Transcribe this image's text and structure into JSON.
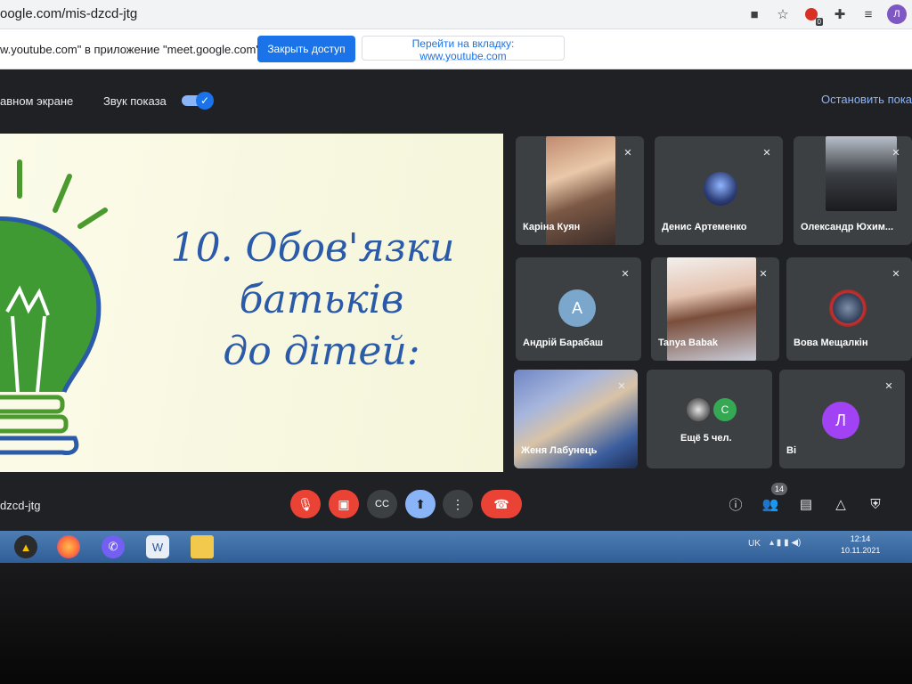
{
  "browser": {
    "url": "oogle.com/mis-dzcd-jtg",
    "profile_initial": "Л",
    "notif_count": "0",
    "icons": [
      "camera-icon",
      "star-icon",
      "extension-badge-icon",
      "puzzle-icon",
      "reading-list-icon",
      "profile-avatar"
    ]
  },
  "infobar": {
    "message": "w.youtube.com\" в приложение \"meet.google.com\" ...",
    "close_access": "Закрыть доступ",
    "go_to_tab": "Перейти на вкладку: www.youtube.com"
  },
  "presentation": {
    "main_screen_label": "авном экране",
    "sound_label": "Звук показа",
    "sound_on": true,
    "stop_label": "Остановить пока"
  },
  "slide": {
    "line1": "10. Обов'язки",
    "line2": "батьків",
    "line3": "до дітей:"
  },
  "participants": [
    {
      "name": "Каріна Куян",
      "type": "video"
    },
    {
      "name": "Денис Артеменко",
      "type": "photo"
    },
    {
      "name": "Олександр Юхим...",
      "type": "photo"
    },
    {
      "name": "Андрій Барабаш",
      "type": "avatar",
      "initial": "А",
      "color": "#7ba7cc"
    },
    {
      "name": "Tanya Babak",
      "type": "video"
    },
    {
      "name": "Вова Мещалкін",
      "type": "photo"
    },
    {
      "name": "Женя Лабунець",
      "type": "video"
    },
    {
      "name": "Ещё 5 чел.",
      "type": "more",
      "initial": "С",
      "color": "#34a853"
    },
    {
      "name": "Ві",
      "type": "avatar",
      "initial": "Л",
      "color": "#a142f4"
    }
  ],
  "meeting": {
    "code": "dzcd-jtg",
    "people_count": "14",
    "controls": [
      "mic-off-icon",
      "camera-off-icon",
      "captions-icon",
      "present-icon",
      "more-options-icon",
      "hang-up-icon"
    ],
    "right_icons": [
      "info-icon",
      "people-icon",
      "chat-icon",
      "activities-icon",
      "host-controls-icon"
    ]
  },
  "taskbar": {
    "lang": "UK",
    "time": "12:14",
    "date": "10.11.2021"
  }
}
